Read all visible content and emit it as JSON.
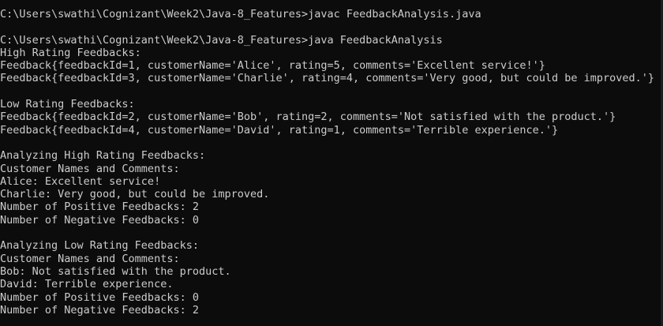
{
  "terminal": {
    "lines": [
      "C:\\Users\\swathi\\Cognizant\\Week2\\Java-8_Features>javac FeedbackAnalysis.java",
      "",
      "C:\\Users\\swathi\\Cognizant\\Week2\\Java-8_Features>java FeedbackAnalysis",
      "High Rating Feedbacks:",
      "Feedback{feedbackId=1, customerName='Alice', rating=5, comments='Excellent service!'}",
      "Feedback{feedbackId=3, customerName='Charlie', rating=4, comments='Very good, but could be improved.'}",
      "",
      "Low Rating Feedbacks:",
      "Feedback{feedbackId=2, customerName='Bob', rating=2, comments='Not satisfied with the product.'}",
      "Feedback{feedbackId=4, customerName='David', rating=1, comments='Terrible experience.'}",
      "",
      "Analyzing High Rating Feedbacks:",
      "Customer Names and Comments:",
      "Alice: Excellent service!",
      "Charlie: Very good, but could be improved.",
      "Number of Positive Feedbacks: 2",
      "Number of Negative Feedbacks: 0",
      "",
      "Analyzing Low Rating Feedbacks:",
      "Customer Names and Comments:",
      "Bob: Not satisfied with the product.",
      "David: Terrible experience.",
      "Number of Positive Feedbacks: 0",
      "Number of Negative Feedbacks: 2"
    ]
  },
  "colors": {
    "background": "#0c0c0c",
    "text": "#cccccc"
  }
}
